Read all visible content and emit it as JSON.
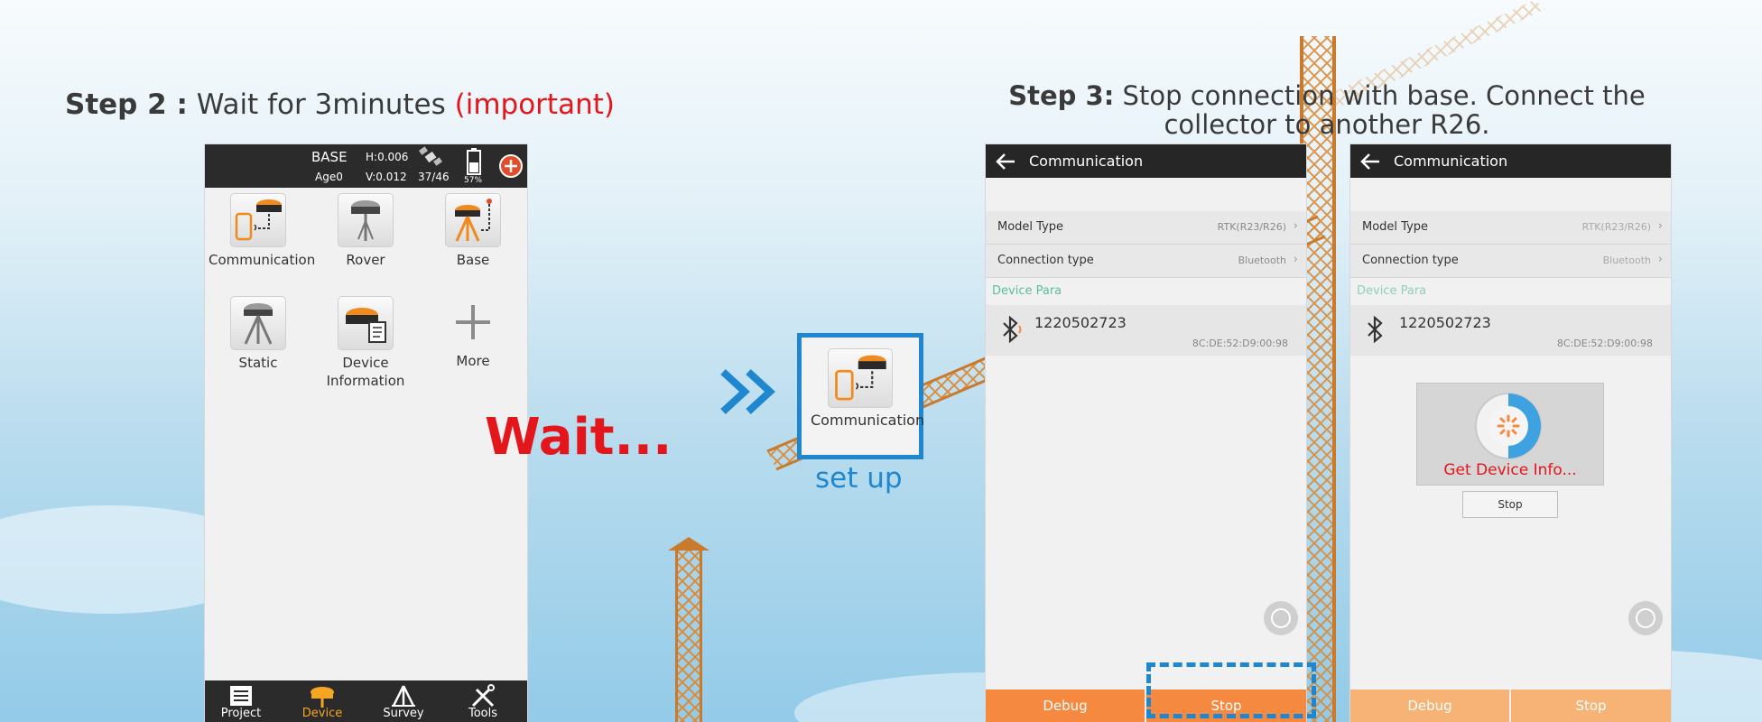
{
  "step2": {
    "label": "Step 2 :",
    "text": "Wait for 3minutes",
    "important": "(important)"
  },
  "step3": {
    "label": "Step 3:",
    "line1": "Stop connection with base. Connect the",
    "line2": "collector to another R26."
  },
  "wait_label": "Wait...",
  "arrows": "»",
  "setup_label": "set up",
  "setup_tile": {
    "label": "Communication"
  },
  "colors": {
    "red": "#e3161b",
    "blue": "#1f87d0",
    "orange": "#f5893f",
    "green": "#5bbd9a"
  },
  "device_screen": {
    "status": {
      "mode": "BASE",
      "age": "Age0",
      "h": "H:0.006",
      "v": "V:0.012",
      "sats": "37/46",
      "battery": "57%"
    },
    "tiles": [
      {
        "label": "Communication",
        "icon": "communication-icon"
      },
      {
        "label": "Rover",
        "icon": "rover-icon"
      },
      {
        "label": "Base",
        "icon": "base-icon"
      },
      {
        "label": "Static",
        "icon": "static-icon"
      },
      {
        "label": "Device Information",
        "icon": "device-info-icon"
      },
      {
        "label": "More",
        "icon": "plus-icon"
      }
    ],
    "nav": [
      {
        "label": "Project",
        "icon": "project-icon"
      },
      {
        "label": "Device",
        "icon": "device-icon"
      },
      {
        "label": "Survey",
        "icon": "survey-icon"
      },
      {
        "label": "Tools",
        "icon": "tools-icon"
      }
    ]
  },
  "comm_screen_a": {
    "title": "Communication",
    "model_type": {
      "label": "Model Type",
      "value": "RTK(R23/R26)"
    },
    "connection_type": {
      "label": "Connection type",
      "value": "Bluetooth"
    },
    "section": "Device Para",
    "device_id": "1220502723",
    "device_mac": "8C:DE:52:D9:00:98",
    "debug_label": "Debug",
    "stop_label": "Stop"
  },
  "comm_screen_b": {
    "title": "Communication",
    "model_type": {
      "label": "Model Type",
      "value": "RTK(R23/R26)"
    },
    "connection_type": {
      "label": "Connection type",
      "value": "Bluetooth"
    },
    "section": "Device Para",
    "device_id": "1220502723",
    "device_mac": "8C:DE:52:D9:00:98",
    "dialog_text": "Get Device Info...",
    "dialog_stop": "Stop",
    "debug_label": "Debug",
    "stop_label": "Stop"
  }
}
